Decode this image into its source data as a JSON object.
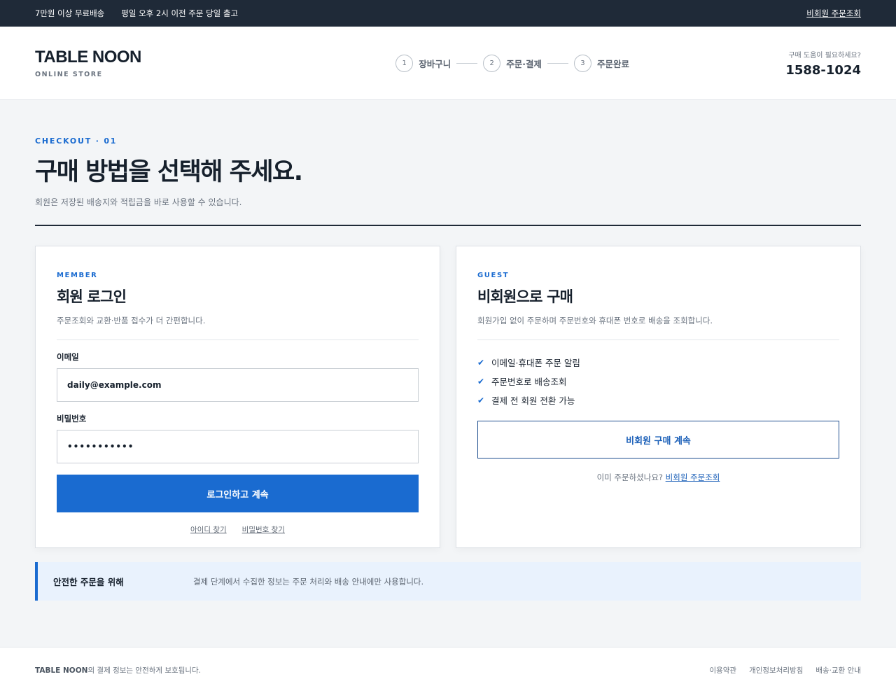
{
  "topbar": {
    "notice_1": "7만원 이상 무료배송",
    "notice_2": "평일 오후 2시 이전 주문 당일 출고",
    "guest_order_link": "비회원 주문조회"
  },
  "header": {
    "logo": "TABLE NOON",
    "logo_sub": "ONLINE STORE",
    "steps": [
      {
        "num": "1",
        "label": "장바구니"
      },
      {
        "num": "2",
        "label": "주문·결제"
      },
      {
        "num": "3",
        "label": "주문완료"
      }
    ],
    "help_question": "구매 도움이 필요하세요?",
    "help_phone": "1588-1024"
  },
  "page": {
    "eyebrow": "CHECKOUT · 01",
    "title": "구매 방법을 선택해 주세요.",
    "description": "회원은 저장된 배송지와 적립금을 바로 사용할 수 있습니다."
  },
  "member": {
    "tag": "MEMBER",
    "title": "회원 로그인",
    "description": "주문조회와 교환·반품 접수가 더 간편합니다.",
    "email_label": "이메일",
    "email_value": "daily@example.com",
    "password_label": "비밀번호",
    "password_value": "•••••••••••",
    "login_button": "로그인하고 계속",
    "find_id": "아이디 찾기",
    "find_password": "비밀번호 찾기"
  },
  "guest": {
    "tag": "GUEST",
    "title": "비회원으로 구매",
    "description": "회원가입 없이 주문하며 주문번호와 휴대폰 번호로 배송을 조회합니다.",
    "benefits": [
      "이메일·휴대폰 주문 알림",
      "주문번호로 배송조회",
      "결제 전 회원 전환 가능"
    ],
    "continue_button": "비회원 구매 계속",
    "already_text": "이미 주문하셨나요?",
    "order_lookup_link": "비회원 주문조회"
  },
  "notice": {
    "title": "안전한 주문을 위해",
    "text": "결제 단계에서 수집한 정보는 주문 처리와 배송 안내에만 사용합니다."
  },
  "footer": {
    "brand": "TABLE NOON",
    "text": "의 결제 정보는 안전하게 보호됩니다.",
    "links": [
      "이용약관",
      "개인정보처리방침",
      "배송·교환 안내"
    ]
  },
  "colors": {
    "accent": "#1a6bd0",
    "dark": "#1f2a38",
    "notice_bg": "#e9f2fd"
  }
}
